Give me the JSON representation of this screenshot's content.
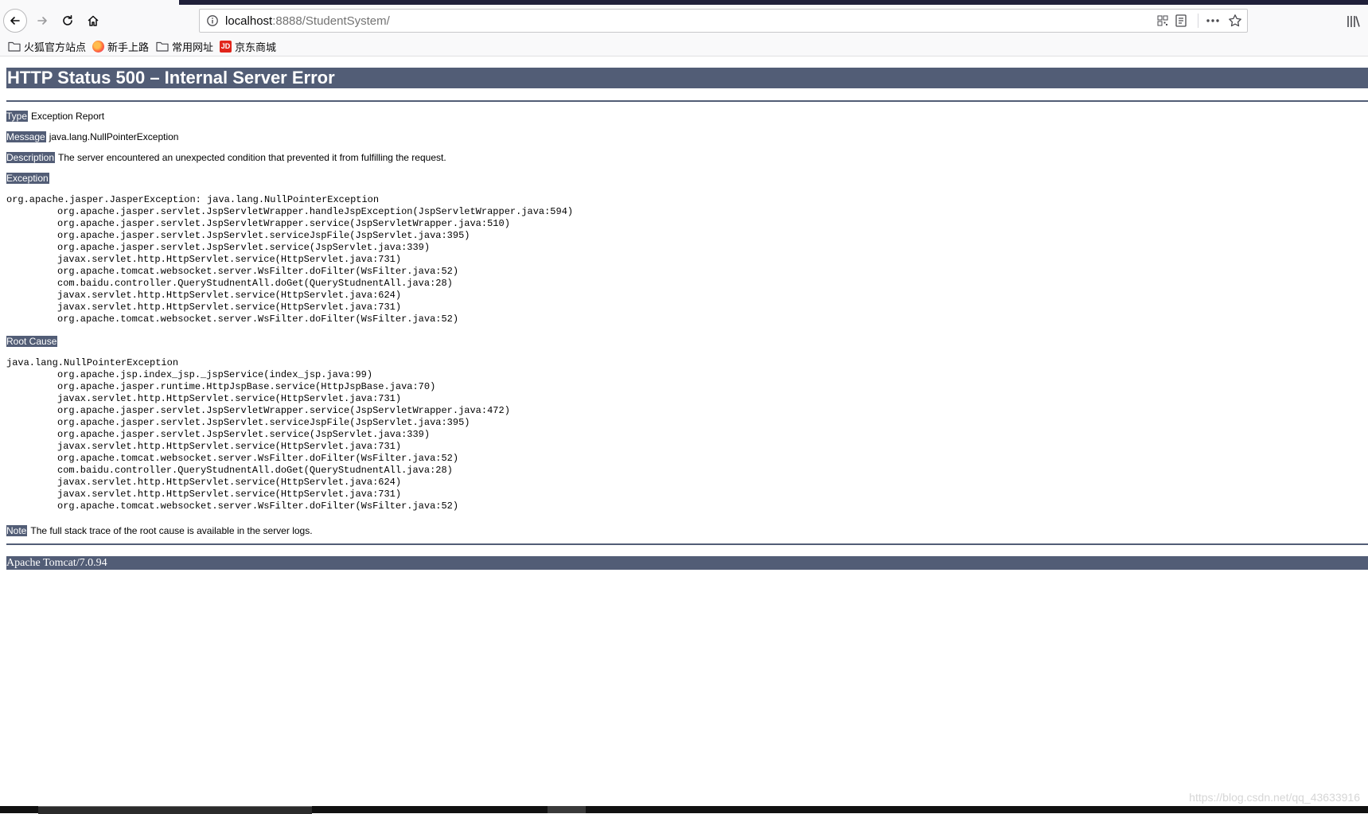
{
  "browser": {
    "url_host": "localhost",
    "url_rest": ":8888/StudentSystem/",
    "bookmarks": [
      "火狐官方站点",
      "新手上路",
      "常用网址",
      "京东商城"
    ],
    "jd_logo_text": "JD"
  },
  "error_page": {
    "title": "HTTP Status 500 – Internal Server Error",
    "type_label": "Type",
    "type_value": "Exception Report",
    "message_label": "Message",
    "message_value": "java.lang.NullPointerException",
    "description_label": "Description",
    "description_value": "The server encountered an unexpected condition that prevented it from fulfilling the request.",
    "exception_label": "Exception",
    "exception_trace": [
      "org.apache.jasper.JasperException: java.lang.NullPointerException",
      "org.apache.jasper.servlet.JspServletWrapper.handleJspException(JspServletWrapper.java:594)",
      "org.apache.jasper.servlet.JspServletWrapper.service(JspServletWrapper.java:510)",
      "org.apache.jasper.servlet.JspServlet.serviceJspFile(JspServlet.java:395)",
      "org.apache.jasper.servlet.JspServlet.service(JspServlet.java:339)",
      "javax.servlet.http.HttpServlet.service(HttpServlet.java:731)",
      "org.apache.tomcat.websocket.server.WsFilter.doFilter(WsFilter.java:52)",
      "com.baidu.controller.QueryStudnentAll.doGet(QueryStudnentAll.java:28)",
      "javax.servlet.http.HttpServlet.service(HttpServlet.java:624)",
      "javax.servlet.http.HttpServlet.service(HttpServlet.java:731)",
      "org.apache.tomcat.websocket.server.WsFilter.doFilter(WsFilter.java:52)"
    ],
    "root_cause_label": "Root Cause",
    "root_cause_trace": [
      "java.lang.NullPointerException",
      "org.apache.jsp.index_jsp._jspService(index_jsp.java:99)",
      "org.apache.jasper.runtime.HttpJspBase.service(HttpJspBase.java:70)",
      "javax.servlet.http.HttpServlet.service(HttpServlet.java:731)",
      "org.apache.jasper.servlet.JspServletWrapper.service(JspServletWrapper.java:472)",
      "org.apache.jasper.servlet.JspServlet.serviceJspFile(JspServlet.java:395)",
      "org.apache.jasper.servlet.JspServlet.service(JspServlet.java:339)",
      "javax.servlet.http.HttpServlet.service(HttpServlet.java:731)",
      "org.apache.tomcat.websocket.server.WsFilter.doFilter(WsFilter.java:52)",
      "com.baidu.controller.QueryStudnentAll.doGet(QueryStudnentAll.java:28)",
      "javax.servlet.http.HttpServlet.service(HttpServlet.java:624)",
      "javax.servlet.http.HttpServlet.service(HttpServlet.java:731)",
      "org.apache.tomcat.websocket.server.WsFilter.doFilter(WsFilter.java:52)"
    ],
    "note_label": "Note",
    "note_value": "The full stack trace of the root cause is available in the server logs.",
    "footer": "Apache Tomcat/7.0.94"
  },
  "watermark": "https://blog.csdn.net/qq_43633916",
  "colors": {
    "tomcat_header": "#525d76",
    "chrome_bg": "#f9f9fa"
  }
}
